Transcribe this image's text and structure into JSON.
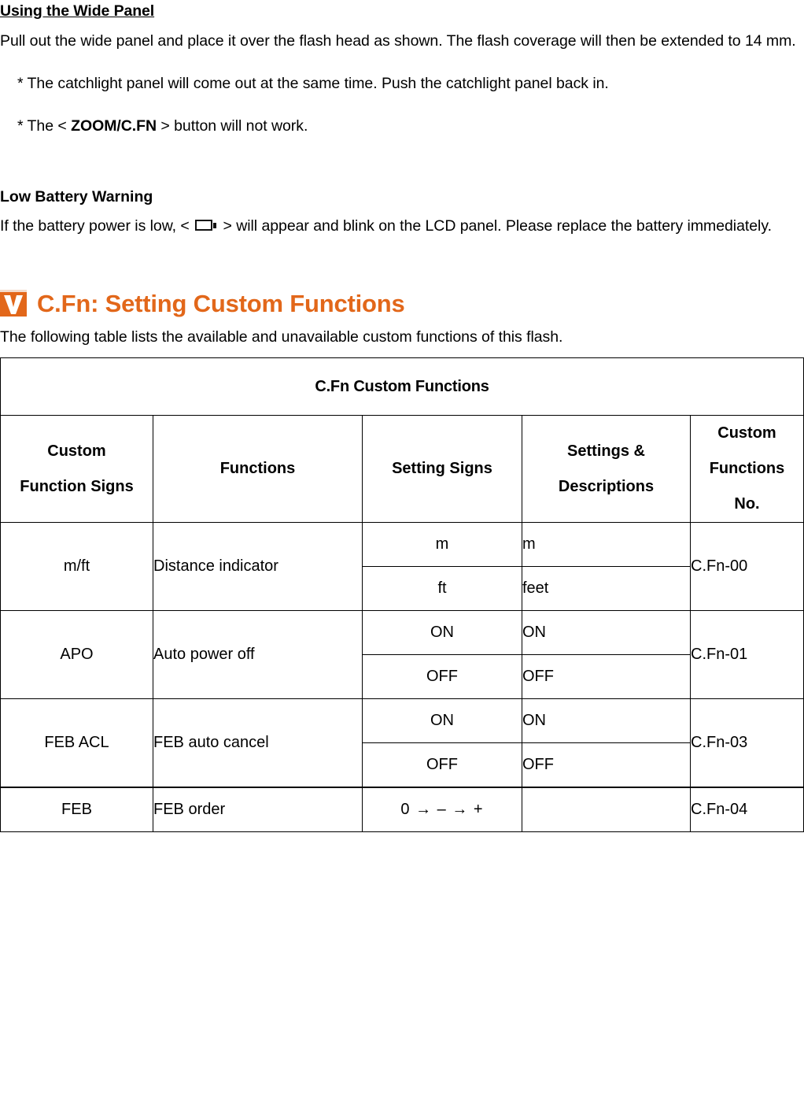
{
  "sections": {
    "wide_panel": {
      "heading": "Using the Wide Panel",
      "paragraph": "Pull out the wide panel and place it over the flash head as shown. The flash coverage will then be extended to 14 mm.",
      "bullets": [
        {
          "prefix": "* The catchlight panel will come out at the same time. Push the catchlight panel back in."
        },
        {
          "pre": "* The < ",
          "bold": "ZOOM/C.FN",
          "post": " > button will not work."
        }
      ]
    },
    "low_battery": {
      "heading": "Low Battery Warning",
      "text_before": "If the battery power is low,  < ",
      "icon": "battery-empty-icon",
      "text_after": " > will appear and blink on the LCD panel. Please replace the battery immediately."
    },
    "custom_functions": {
      "icon": "orange-checkmark-icon",
      "icon_color": "#E2671A",
      "title": "C.Fn: Setting Custom Functions",
      "intro": "The following table lists the available and unavailable custom functions of this flash."
    }
  },
  "table": {
    "title": "C.Fn Custom Functions",
    "headers": {
      "col1_line1": "Custom",
      "col1_line2": "Function Signs",
      "col2": "Functions",
      "col3": "Setting Signs",
      "col4_line1": "Settings &",
      "col4_line2": "Descriptions",
      "col5_line1": "Custom",
      "col5_line2": "Functions",
      "col5_line3": "No."
    },
    "rows": [
      {
        "sign": "m/ft",
        "function": "Distance indicator",
        "settings": [
          {
            "setting_sign": "m",
            "description": "m"
          },
          {
            "setting_sign": "ft",
            "description": "feet"
          }
        ],
        "number": "C.Fn-00"
      },
      {
        "sign": "APO",
        "function": "Auto power off",
        "settings": [
          {
            "setting_sign": "ON",
            "description": "ON"
          },
          {
            "setting_sign": "OFF",
            "description": "OFF"
          }
        ],
        "number": "C.Fn-01"
      },
      {
        "sign": "FEB ACL",
        "function": "FEB auto cancel",
        "settings": [
          {
            "setting_sign": "ON",
            "description": "ON"
          },
          {
            "setting_sign": "OFF",
            "description": "OFF"
          }
        ],
        "number": "C.Fn-03"
      },
      {
        "sign": "FEB",
        "function": "FEB order",
        "settings": [
          {
            "setting_sign": "0  →  –  →  +",
            "description": ""
          }
        ],
        "number": "C.Fn-04"
      }
    ]
  }
}
